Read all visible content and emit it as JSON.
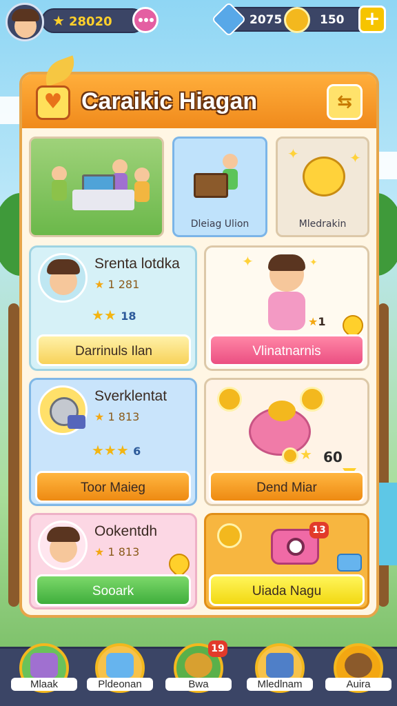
{
  "topbar": {
    "star_count": "28020",
    "gems": "2075",
    "coins": "150",
    "plus_label": "+"
  },
  "panel": {
    "title": "Caraikic Hiagan"
  },
  "tiles": [
    {
      "label": ""
    },
    {
      "label": "Dleiag Ulion"
    },
    {
      "label": "Mledrakin"
    }
  ],
  "cards": {
    "c1": {
      "name": "Srenta lotdka",
      "rating": "1 281",
      "stars_count": "18",
      "button": "Darrinuls Ilan"
    },
    "c2": {
      "rating": "1",
      "button": "Vlinatnarnis"
    },
    "c3": {
      "name": "Sverklentat",
      "rating": "1 813",
      "stars_count": "6",
      "button": "Toor Maieg"
    },
    "c4": {
      "count": "60",
      "button": "Dend Miar"
    },
    "c5": {
      "name": "Ookentdh",
      "rating": "1 813",
      "button": "Sooark"
    },
    "c6": {
      "badge": "13",
      "button": "Uiada Nagu"
    }
  },
  "nav": [
    {
      "label": "Mlaak",
      "badge": ""
    },
    {
      "label": "Pldeonan",
      "badge": ""
    },
    {
      "label": "Bwa",
      "badge": "19"
    },
    {
      "label": "Mledlnam",
      "badge": ""
    },
    {
      "label": "Auira",
      "badge": ""
    }
  ],
  "colors": {
    "panel_border": "#e6a54a",
    "header_orange": "#f08a1c",
    "nav_bg": "#3b4566"
  }
}
